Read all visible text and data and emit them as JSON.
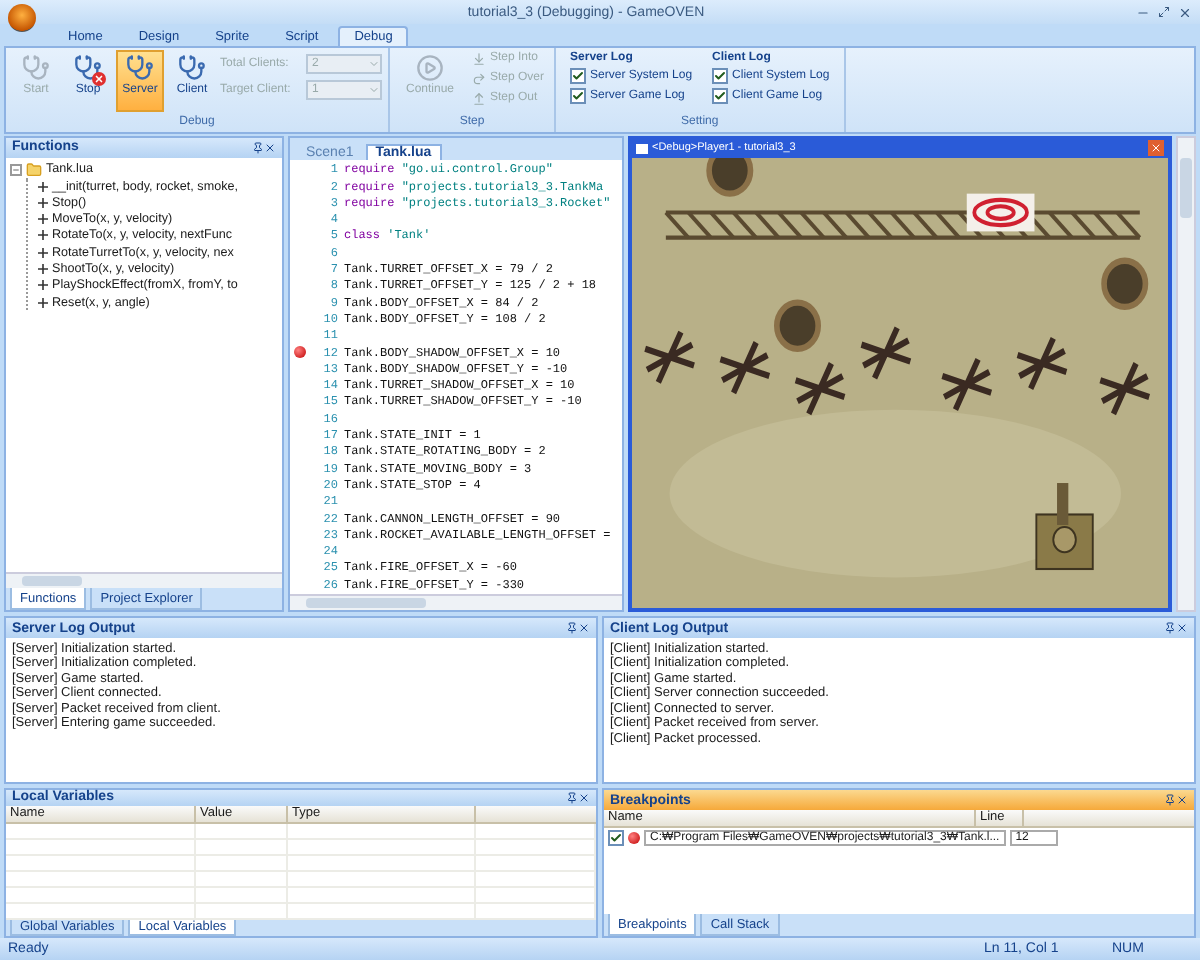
{
  "window": {
    "title": "tutorial3_3 (Debugging) - GameOVEN"
  },
  "ribbon": {
    "tabs": [
      {
        "label": "Home",
        "selected": false
      },
      {
        "label": "Design",
        "selected": false
      },
      {
        "label": "Sprite",
        "selected": false
      },
      {
        "label": "Script",
        "selected": false
      },
      {
        "label": "Debug",
        "selected": true
      }
    ],
    "groups": [
      {
        "kind": "debug",
        "label": "Debug",
        "buttons": [
          {
            "label": "Start",
            "disabled": true,
            "selected": false
          },
          {
            "label": "Stop",
            "disabled": false,
            "selected": false
          },
          {
            "label": "Server",
            "disabled": false,
            "selected": true
          },
          {
            "label": "Client",
            "disabled": false,
            "selected": false
          }
        ],
        "fields": [
          {
            "label": "Total Clients:",
            "value": "2",
            "disabled": true
          },
          {
            "label": "Target Client:",
            "value": "1",
            "disabled": true
          }
        ]
      },
      {
        "kind": "step",
        "label": "Step",
        "buttons": [
          {
            "label": "Continue",
            "disabled": true
          },
          {
            "label": "Step Into",
            "disabled": true
          },
          {
            "label": "Step Over",
            "disabled": true
          },
          {
            "label": "Step Out",
            "disabled": true
          }
        ]
      },
      {
        "kind": "setting",
        "label": "Setting",
        "columns": [
          {
            "title": "Server Log",
            "options": [
              {
                "label": "Server System Log",
                "checked": true
              },
              {
                "label": "Server Game Log",
                "checked": true
              }
            ]
          },
          {
            "title": "Client Log",
            "options": [
              {
                "label": "Client System Log",
                "checked": true
              },
              {
                "label": "Client Game Log",
                "checked": true
              }
            ]
          }
        ]
      }
    ]
  },
  "functions_panel": {
    "title": "Functions",
    "active": false,
    "tree": [
      {
        "label": "Tank.lua",
        "expanded": true,
        "children": [
          {
            "label": "__init(turret, body, rocket, smoke,"
          },
          {
            "label": "Stop()"
          },
          {
            "label": "MoveTo(x, y, velocity)"
          },
          {
            "label": "RotateTo(x, y, velocity, nextFunc"
          },
          {
            "label": "RotateTurretTo(x, y, velocity, nex"
          },
          {
            "label": "ShootTo(x, y, velocity)"
          },
          {
            "label": "PlayShockEffect(fromX, fromY, to"
          },
          {
            "label": "Reset(x, y, angle)"
          }
        ]
      }
    ],
    "tabs": [
      {
        "label": "Functions",
        "selected": true
      },
      {
        "label": "Project Explorer",
        "selected": false
      }
    ]
  },
  "editor": {
    "tabs": [
      {
        "label": "Scene1",
        "selected": false
      },
      {
        "label": "Tank.lua",
        "selected": true
      }
    ],
    "lines": [
      {
        "number": "1",
        "breakpoint": false,
        "tokens": [
          {
            "text": "require ",
            "kind": "keyword"
          },
          {
            "text": "\"go.ui.control.Group\"",
            "kind": "string"
          }
        ]
      },
      {
        "number": "2",
        "breakpoint": false,
        "tokens": [
          {
            "text": "require ",
            "kind": "keyword"
          },
          {
            "text": "\"projects.tutorial3_3.TankMa",
            "kind": "string"
          }
        ]
      },
      {
        "number": "3",
        "breakpoint": false,
        "tokens": [
          {
            "text": "require ",
            "kind": "keyword"
          },
          {
            "text": "\"projects.tutorial3_3.Rocket\"",
            "kind": "string"
          }
        ]
      },
      {
        "number": "4",
        "breakpoint": false
      },
      {
        "number": "5",
        "breakpoint": false,
        "tokens": [
          {
            "text": "class ",
            "kind": "keyword"
          },
          {
            "text": "'Tank'",
            "kind": "string"
          }
        ]
      },
      {
        "number": "6",
        "breakpoint": false
      },
      {
        "number": "7",
        "breakpoint": false,
        "tokens": [
          {
            "text": "Tank.TURRET_OFFSET_X = 79 / 2",
            "kind": "plain"
          }
        ]
      },
      {
        "number": "8",
        "breakpoint": false,
        "tokens": [
          {
            "text": "Tank.TURRET_OFFSET_Y = 125 / 2 + 18",
            "kind": "plain"
          }
        ]
      },
      {
        "number": "9",
        "breakpoint": false,
        "tokens": [
          {
            "text": "Tank.BODY_OFFSET_X = 84 / 2",
            "kind": "plain"
          }
        ]
      },
      {
        "number": "10",
        "breakpoint": false,
        "tokens": [
          {
            "text": "Tank.BODY_OFFSET_Y = 108 / 2",
            "kind": "plain"
          }
        ]
      },
      {
        "number": "11",
        "breakpoint": false
      },
      {
        "number": "12",
        "breakpoint": true,
        "tokens": [
          {
            "text": "Tank.BODY_SHADOW_OFFSET_X = 10",
            "kind": "plain"
          }
        ]
      },
      {
        "number": "13",
        "breakpoint": false,
        "tokens": [
          {
            "text": "Tank.BODY_SHADOW_OFFSET_Y = -10",
            "kind": "plain"
          }
        ]
      },
      {
        "number": "14",
        "breakpoint": false,
        "tokens": [
          {
            "text": "Tank.TURRET_SHADOW_OFFSET_X = 10",
            "kind": "plain"
          }
        ]
      },
      {
        "number": "15",
        "breakpoint": false,
        "tokens": [
          {
            "text": "Tank.TURRET_SHADOW_OFFSET_Y = -10",
            "kind": "plain"
          }
        ]
      },
      {
        "number": "16",
        "breakpoint": false
      },
      {
        "number": "17",
        "breakpoint": false,
        "tokens": [
          {
            "text": "Tank.STATE_INIT = 1",
            "kind": "plain"
          }
        ]
      },
      {
        "number": "18",
        "breakpoint": false,
        "tokens": [
          {
            "text": "Tank.STATE_ROTATING_BODY = 2",
            "kind": "plain"
          }
        ]
      },
      {
        "number": "19",
        "breakpoint": false,
        "tokens": [
          {
            "text": "Tank.STATE_MOVING_BODY = 3",
            "kind": "plain"
          }
        ]
      },
      {
        "number": "20",
        "breakpoint": false,
        "tokens": [
          {
            "text": "Tank.STATE_STOP = 4",
            "kind": "plain"
          }
        ]
      },
      {
        "number": "21",
        "breakpoint": false
      },
      {
        "number": "22",
        "breakpoint": false,
        "tokens": [
          {
            "text": "Tank.CANNON_LENGTH_OFFSET = 90",
            "kind": "plain"
          }
        ]
      },
      {
        "number": "23",
        "breakpoint": false,
        "tokens": [
          {
            "text": "Tank.ROCKET_AVAILABLE_LENGTH_OFFSET =",
            "kind": "plain"
          }
        ]
      },
      {
        "number": "24",
        "breakpoint": false
      },
      {
        "number": "25",
        "breakpoint": false,
        "tokens": [
          {
            "text": "Tank.FIRE_OFFSET_X = -60",
            "kind": "plain"
          }
        ]
      },
      {
        "number": "26",
        "breakpoint": false,
        "tokens": [
          {
            "text": "Tank.FIRE_OFFSET_Y = -330",
            "kind": "plain"
          }
        ]
      }
    ]
  },
  "game_window": {
    "title": "<Debug>Player1 - tutorial3_3"
  },
  "server_log": {
    "title": "Server Log Output",
    "active": false,
    "lines": [
      "[Server] Initialization started.",
      "[Server] Initialization completed.",
      "[Server] Game started.",
      "[Server] Client connected.",
      "[Server] Packet received from client.",
      "[Server] Entering game succeeded."
    ]
  },
  "client_log": {
    "title": "Client Log Output",
    "active": false,
    "lines": [
      "[Client] Initialization started.",
      "[Client] Initialization completed.",
      "[Client] Game started.",
      "[Client] Server connection succeeded.",
      "[Client] Connected to server.",
      "[Client] Packet received from server.",
      "[Client] Packet processed."
    ]
  },
  "local_variables": {
    "title": "Local Variables",
    "active": false,
    "columns": [
      "Name",
      "Value",
      "Type"
    ],
    "tabs": [
      {
        "label": "Global Variables",
        "selected": false
      },
      {
        "label": "Local Variables",
        "selected": true
      }
    ]
  },
  "breakpoints": {
    "title": "Breakpoints",
    "active": true,
    "columns": [
      "Name",
      "Line"
    ],
    "rows": [
      {
        "checked": true,
        "name": "C:₩Program Files₩GameOVEN₩projects₩tutorial3_3₩Tank.l...",
        "line": "12"
      }
    ],
    "tabs": [
      {
        "label": "Breakpoints",
        "selected": true
      },
      {
        "label": "Call Stack",
        "selected": false
      }
    ]
  },
  "status_bar": {
    "message": "Ready",
    "position": "Ln 11, Col 1",
    "num": "NUM"
  }
}
